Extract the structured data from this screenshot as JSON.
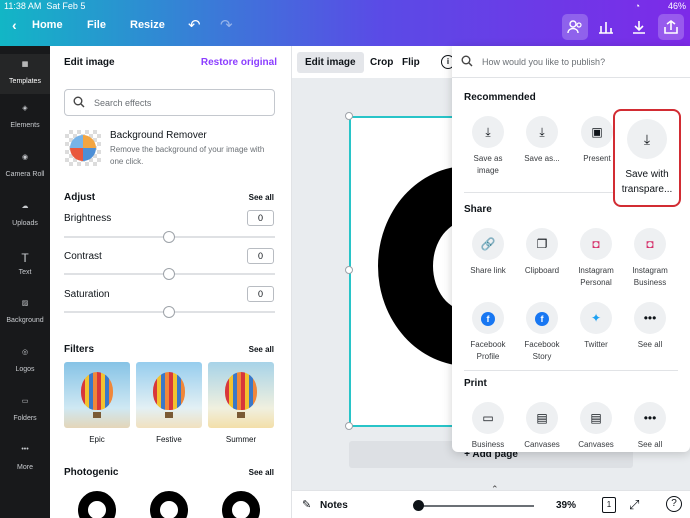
{
  "status_bar": {
    "time": "11:38 AM",
    "date": "Sat Feb 5",
    "battery": "46%"
  },
  "topbar": {
    "back_icon": "chevron-left-icon",
    "home": "Home",
    "file": "File",
    "resize": "Resize",
    "undo_icon": "undo-icon",
    "redo_icon": "redo-icon",
    "icons": [
      "share-people-icon",
      "insights-icon",
      "download-icon",
      "publish-icon"
    ],
    "gradient": [
      "#12b6c6",
      "#7d2ae8"
    ]
  },
  "rail": {
    "items": [
      {
        "label": "Templates",
        "icon": "templates-icon"
      },
      {
        "label": "Elements",
        "icon": "elements-icon"
      },
      {
        "label": "Camera Roll",
        "icon": "camera-icon"
      },
      {
        "label": "Uploads",
        "icon": "upload-cloud-icon"
      },
      {
        "label": "Text",
        "icon": "text-icon"
      },
      {
        "label": "Background",
        "icon": "background-icon"
      },
      {
        "label": "Logos",
        "icon": "logos-icon"
      },
      {
        "label": "Folders",
        "icon": "folder-icon"
      },
      {
        "label": "More",
        "icon": "more-icon"
      }
    ]
  },
  "panel": {
    "title": "Edit image",
    "restore": "Restore original",
    "search_placeholder": "Search effects",
    "bg_remover": {
      "title": "Background Remover",
      "desc": "Remove the background of your image with one click."
    },
    "adjust": {
      "title": "Adjust",
      "see_all": "See all",
      "sliders": [
        {
          "label": "Brightness",
          "value": "0"
        },
        {
          "label": "Contrast",
          "value": "0"
        },
        {
          "label": "Saturation",
          "value": "0"
        }
      ]
    },
    "filters": {
      "title": "Filters",
      "see_all": "See all",
      "items": [
        "Epic",
        "Festive",
        "Summer"
      ]
    },
    "photogenic": {
      "title": "Photogenic",
      "see_all": "See all"
    },
    "accent": "#8b3dff"
  },
  "toolbar": {
    "edit_image": "Edit image",
    "crop": "Crop",
    "flip": "Flip",
    "info": "i"
  },
  "canvas": {
    "add_page": "+ Add page"
  },
  "bottom": {
    "notes": "Notes",
    "zoom": "39%",
    "page": "1"
  },
  "publish": {
    "search_placeholder": "How would you like to publish?",
    "recommended": {
      "title": "Recommended",
      "items": [
        {
          "label": "Save as image",
          "icon": "download-icon"
        },
        {
          "label": "Save as...",
          "icon": "download-icon"
        },
        {
          "label": "Present",
          "icon": "present-icon"
        },
        {
          "label": "Save with transpare...",
          "icon": "download-icon"
        }
      ]
    },
    "share": {
      "title": "Share",
      "items": [
        {
          "label": "Share link",
          "icon": "link-icon"
        },
        {
          "label": "Clipboard",
          "icon": "clipboard-icon"
        },
        {
          "label": "Instagram Personal",
          "icon": "instagram-icon"
        },
        {
          "label": "Instagram Business",
          "icon": "instagram-icon"
        },
        {
          "label": "Facebook Profile",
          "icon": "facebook-icon"
        },
        {
          "label": "Facebook Story",
          "icon": "facebook-icon"
        },
        {
          "label": "Twitter",
          "icon": "twitter-icon"
        },
        {
          "label": "See all",
          "icon": "more-icon"
        }
      ]
    },
    "print": {
      "title": "Print",
      "items": [
        {
          "label": "Business",
          "icon": "business-card-icon"
        },
        {
          "label": "Canvases",
          "icon": "canvas-print-icon"
        },
        {
          "label": "Canvases",
          "icon": "canvas-print-icon"
        },
        {
          "label": "See all",
          "icon": "more-icon"
        }
      ]
    },
    "highlight_color": "#d22c33"
  }
}
